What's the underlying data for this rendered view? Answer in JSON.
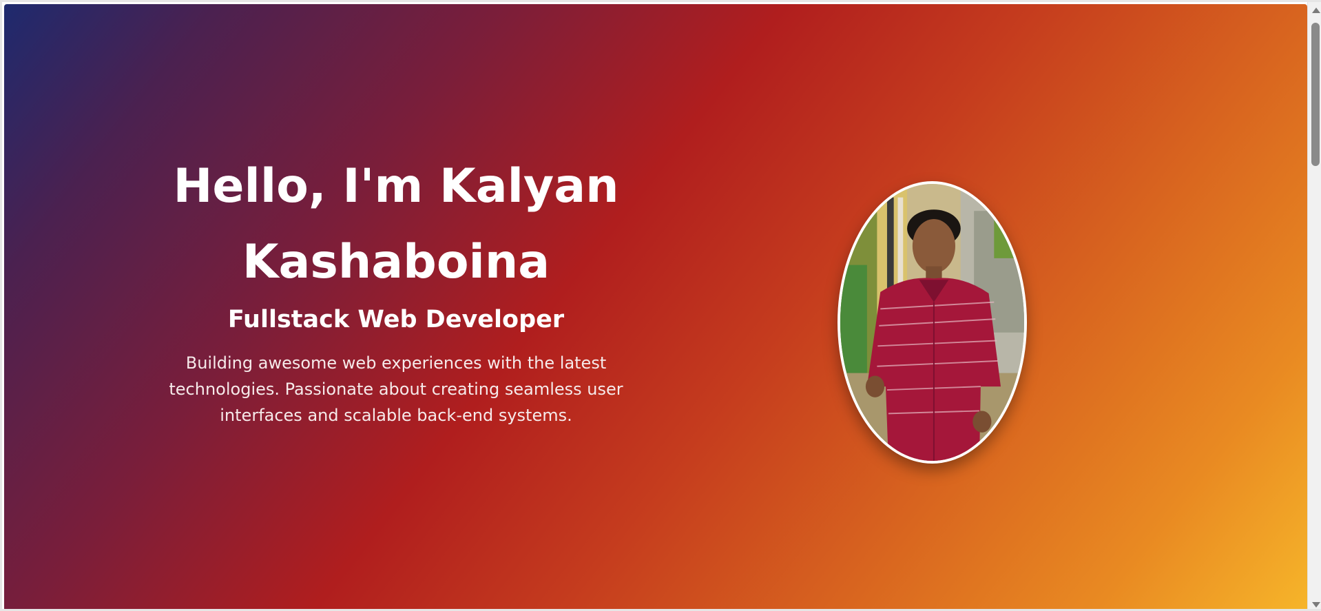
{
  "hero": {
    "greeting": "Hello, I'm Kalyan Kashaboina",
    "role": "Fullstack Web Developer",
    "description": "Building awesome web experiences with the latest technologies. Passionate about creating seamless user interfaces and scalable back-end systems.",
    "portrait_icon": "profile-photo",
    "gradient_colors": [
      "#1e2a6e",
      "#b01e1e",
      "#f6b52a"
    ]
  },
  "scrollbar": {
    "up_icon": "scroll-up-arrow",
    "down_icon": "scroll-down-arrow"
  }
}
